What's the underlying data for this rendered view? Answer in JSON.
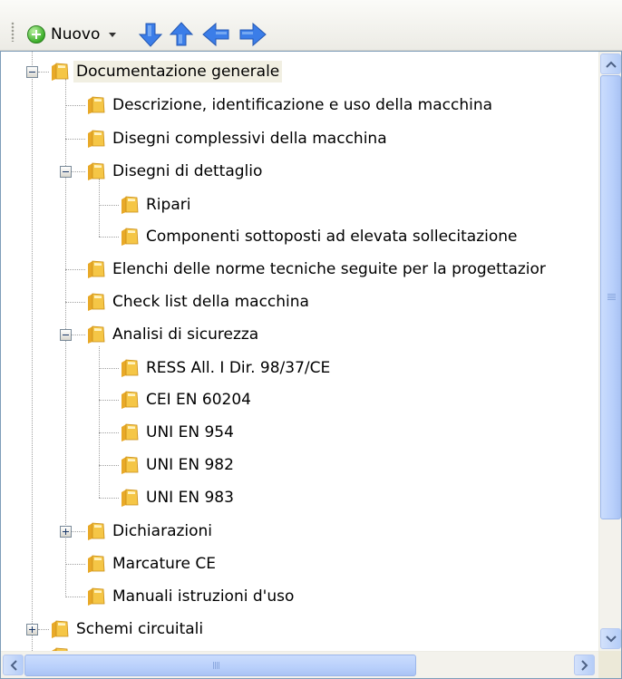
{
  "toolbar": {
    "new_label": "Nuovo",
    "icons": [
      "new-icon",
      "dropdown-caret-icon",
      "arrow-down-icon",
      "arrow-up-icon",
      "arrow-left-icon",
      "arrow-right-icon"
    ],
    "arrow_color": "#3b7de8",
    "new_icon_color": "#3cae2a"
  },
  "tree": {
    "selected_color": "#f1efe2",
    "folder_color": "#f5c646",
    "nodes": [
      {
        "label": "Documentazione generale",
        "expanded": true,
        "selected": true
      },
      {
        "label": "Descrizione, identificazione e uso della macchina"
      },
      {
        "label": "Disegni complessivi della macchina"
      },
      {
        "label": "Disegni di dettaglio",
        "expanded": true
      },
      {
        "label": "Ripari"
      },
      {
        "label": "Componenti sottoposti ad elevata sollecitazione"
      },
      {
        "label": "Elenchi delle norme tecniche seguite per la progettazior"
      },
      {
        "label": "Check list della macchina"
      },
      {
        "label": "Analisi di sicurezza",
        "expanded": true
      },
      {
        "label": "RESS All. I Dir. 98/37/CE"
      },
      {
        "label": "CEI EN 60204"
      },
      {
        "label": "UNI EN 954"
      },
      {
        "label": "UNI EN 982"
      },
      {
        "label": "UNI EN 983"
      },
      {
        "label": "Dichiarazioni",
        "expanded": false
      },
      {
        "label": "Marcature CE"
      },
      {
        "label": "Manuali istruzioni d'uso"
      },
      {
        "label": "Schemi circuitali",
        "expanded": false
      }
    ]
  }
}
